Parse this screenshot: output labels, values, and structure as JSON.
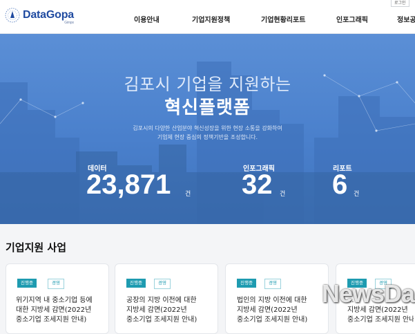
{
  "header": {
    "logo_text": "DataGopa",
    "logo_sub": "Gimpo",
    "login_label": "로그인",
    "nav": [
      "이용안내",
      "기업지원정책",
      "기업현황리포트",
      "인포그래픽",
      "정보공"
    ]
  },
  "hero": {
    "title": "김포시 기업을 지원하는",
    "title_strong": "혁신플랫폼",
    "desc_line1": "김포시의 다양한 산업분야 혁신성장을 위한 현장 소통을 강화하여",
    "desc_line2": "기업체 현장 중심의 정책기반을 조성합니다.",
    "stats": [
      {
        "label": "데이터",
        "value": "23,871",
        "unit": "건"
      },
      {
        "label": "인포그래픽",
        "value": "32",
        "unit": "건"
      },
      {
        "label": "리포트",
        "value": "6",
        "unit": "건"
      }
    ]
  },
  "section": {
    "title": "기업지원 사업",
    "cards": [
      {
        "status": "진행중",
        "type": "경영",
        "lines": [
          "위기지역 내 중소기업 등에",
          "대한 지방세 감면(2022년",
          "중소기업 조세지원 안내)"
        ]
      },
      {
        "status": "진행중",
        "type": "경영",
        "lines": [
          "공장의 지방 이전에 대한",
          "지방세 감면(2022년",
          "중소기업 조세지원 안내)"
        ]
      },
      {
        "status": "진행중",
        "type": "경영",
        "lines": [
          "법인의 지방 이전에 대한",
          "지방세 감면(2022년",
          "중소기업 조세지원 안내)"
        ]
      },
      {
        "status": "진행중",
        "type": "경영",
        "lines": [
          "...",
          "지방세 감면(2022년",
          "중소기업 조세지원 안내)"
        ]
      }
    ]
  },
  "watermark": "NewsDa",
  "colors": {
    "brand": "#1f4aa0",
    "hero": "#4a80cc",
    "tag": "#1e9bb0"
  }
}
